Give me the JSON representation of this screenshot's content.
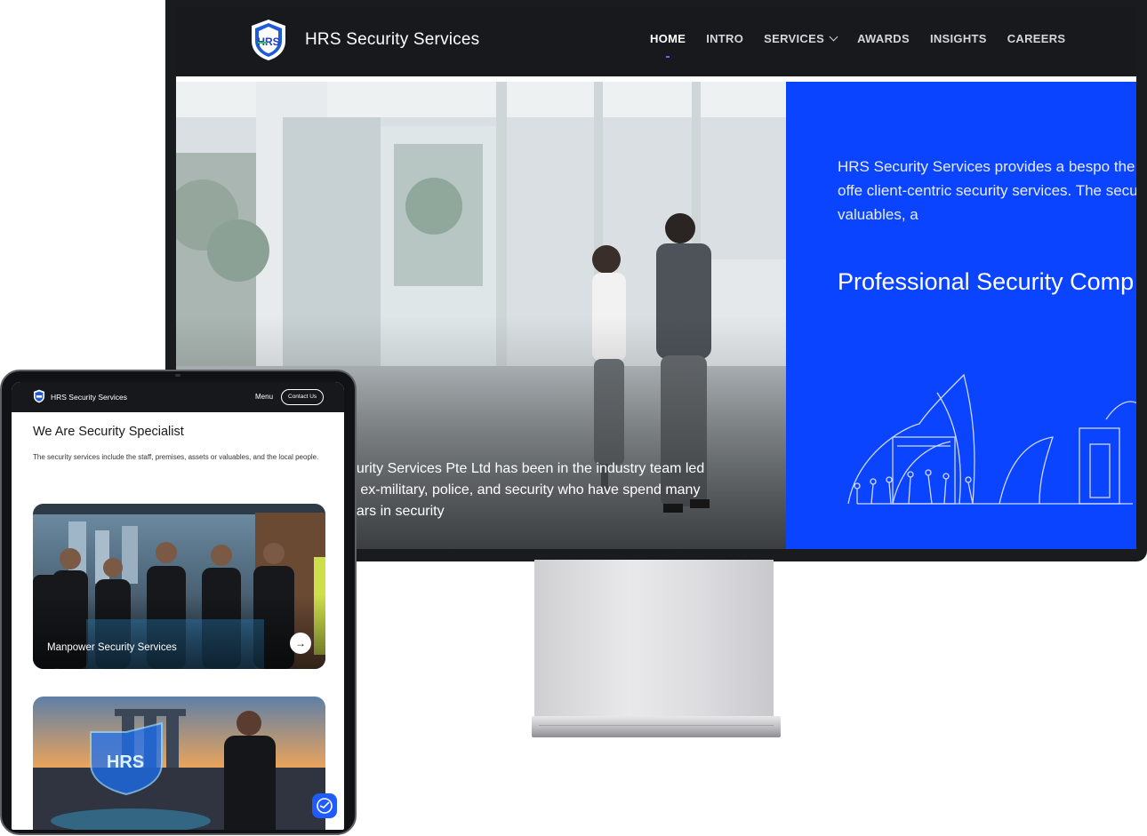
{
  "desktop": {
    "brand": "HRS Security Services",
    "logo_text": "HRS",
    "nav": [
      {
        "label": "HOME",
        "active": true
      },
      {
        "label": "INTRO"
      },
      {
        "label": "SERVICES",
        "has_dropdown": true
      },
      {
        "label": "AWARDS"
      },
      {
        "label": "INSIGHTS"
      },
      {
        "label": "CAREERS"
      }
    ],
    "hero_overlay_text": "ecurity Services Pte Ltd has been in the industry team led by ex-military, police, and security who have spend many years in security",
    "hero_blue_text": "HRS Security Services provides a bespo the clients' requirements focused on offe client-centric security services. The secu the staff, premises, assets or valuables, a",
    "hero_blue_title": "Professional Security Comp Singapore",
    "colors": {
      "accent_blue": "#0a44ff",
      "nav_bg": "#18191d",
      "active_underline": "#3a7bff"
    }
  },
  "tablet": {
    "brand": "HRS Security Services",
    "menu_label": "Menu",
    "contact_label": "Contact Us",
    "section_title": "We Are Security Specialist",
    "section_desc": "The security services include the staff, premises, assets or valuables, and the local people.",
    "cards": [
      {
        "label": "Manpower Security Services",
        "icon": "arrow-right-icon"
      },
      {
        "label": ""
      }
    ],
    "chat_icon": "chat-icon"
  }
}
